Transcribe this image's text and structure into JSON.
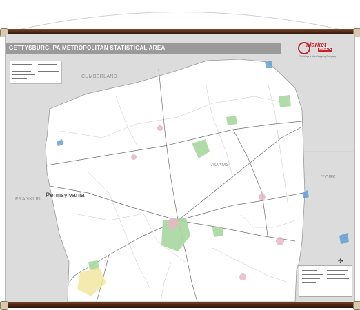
{
  "title": "GETTYSBURG, PA METROPOLITAN STATISTICAL AREA",
  "logo": {
    "name": "Market",
    "sub": "MAPS",
    "tagline": "The Maps & More Mapping Company"
  },
  "labels": {
    "cumberland": "CUMBERLAND",
    "adams": "ADAMS",
    "york": "YORK",
    "franklin": "FRANKLIN",
    "state": "Pennsylvania"
  },
  "colors": {
    "county_fill": "#ffffff",
    "outside_fill": "#d8d8d8",
    "water": "#5b9bd5",
    "parks": "#a8d8a0",
    "title_bar": "#9a9a9a",
    "rod": "#4a2412"
  },
  "icons": {
    "compass": "north-arrow-icon",
    "logo": "market-maps-logo"
  }
}
